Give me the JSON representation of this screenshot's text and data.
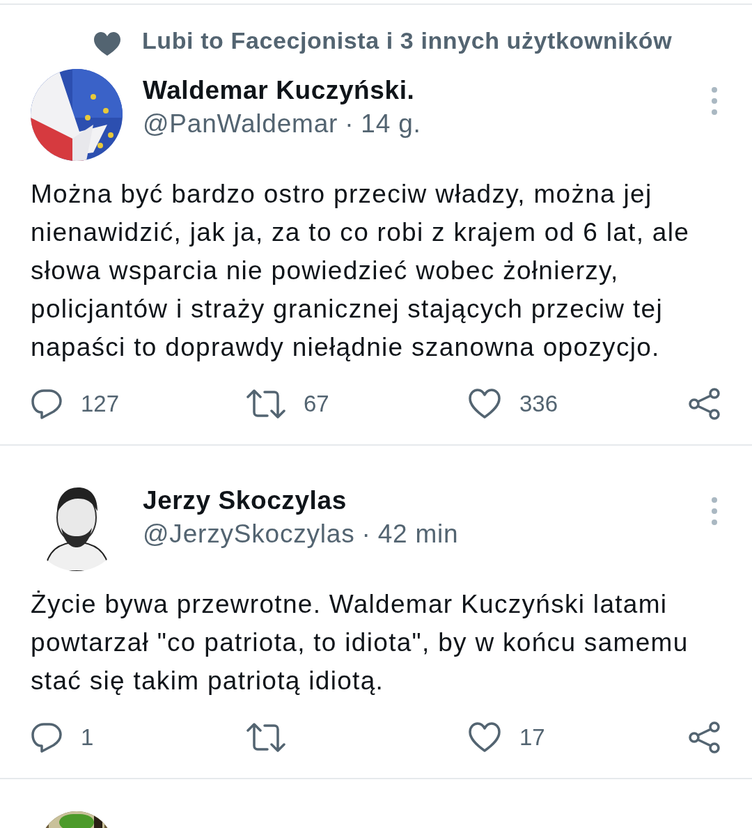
{
  "tweets": [
    {
      "social_context": "Lubi to Facecjonista i 3 innych użytkowników",
      "name": "Waldemar Kuczyński.",
      "handle": "@PanWaldemar",
      "separator": "·",
      "time": "14 g.",
      "text": "Można być bardzo ostro przeciw władzy, można jej nienawidzić, jak ja, za to co robi z krajem od 6 lat, ale słowa wsparcia nie powiedzieć wobec żołnierzy, policjantów i straży granicznej stających przeciw tej napaści to doprawdy niełądnie szanowna opozycjo.",
      "replies": "127",
      "retweets": "67",
      "likes": "336"
    },
    {
      "name": "Jerzy Skoczylas",
      "handle": "@JerzySkoczylas",
      "separator": "·",
      "time": "42 min",
      "text": "Życie bywa przewrotne. Waldemar Kuczyński latami powtarzał \"co patriota, to idiota\", by w końcu samemu stać się takim patriotą idiotą.",
      "replies": "1",
      "likes": "17"
    }
  ]
}
